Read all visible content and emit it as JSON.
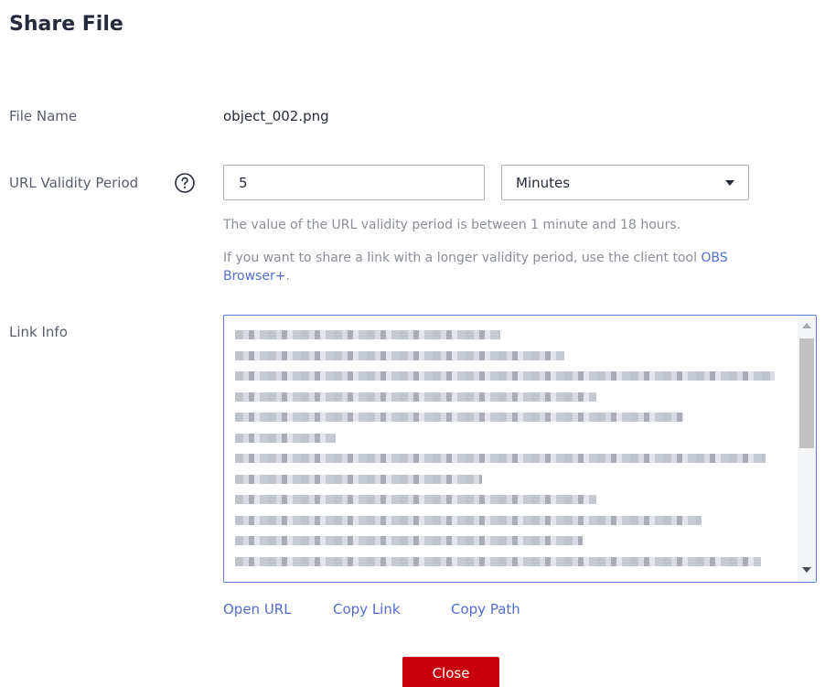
{
  "dialog": {
    "title": "Share File"
  },
  "file_name": {
    "label": "File Name",
    "value": "object_002.png"
  },
  "validity": {
    "label": "URL Validity Period",
    "help_icon": "question-circle-icon",
    "value": "5",
    "unit_selected": "Minutes",
    "hint1": "The value of the URL validity period is between 1 minute and 18 hours.",
    "hint2_prefix": "If you want to share a link with a longer validity period, use the client tool ",
    "hint2_link_line1": "OBS",
    "hint2_link_line2": "Browser+",
    "hint2_suffix": "."
  },
  "link_info": {
    "label": "Link Info"
  },
  "actions": {
    "open_url": "Open URL",
    "copy_link": "Copy Link",
    "copy_path": "Copy Path"
  },
  "footer": {
    "close_label": "Close"
  },
  "colors": {
    "accent": "#526ecc",
    "primary_button": "#c7000b",
    "focus_border": "#5e7ce0"
  }
}
